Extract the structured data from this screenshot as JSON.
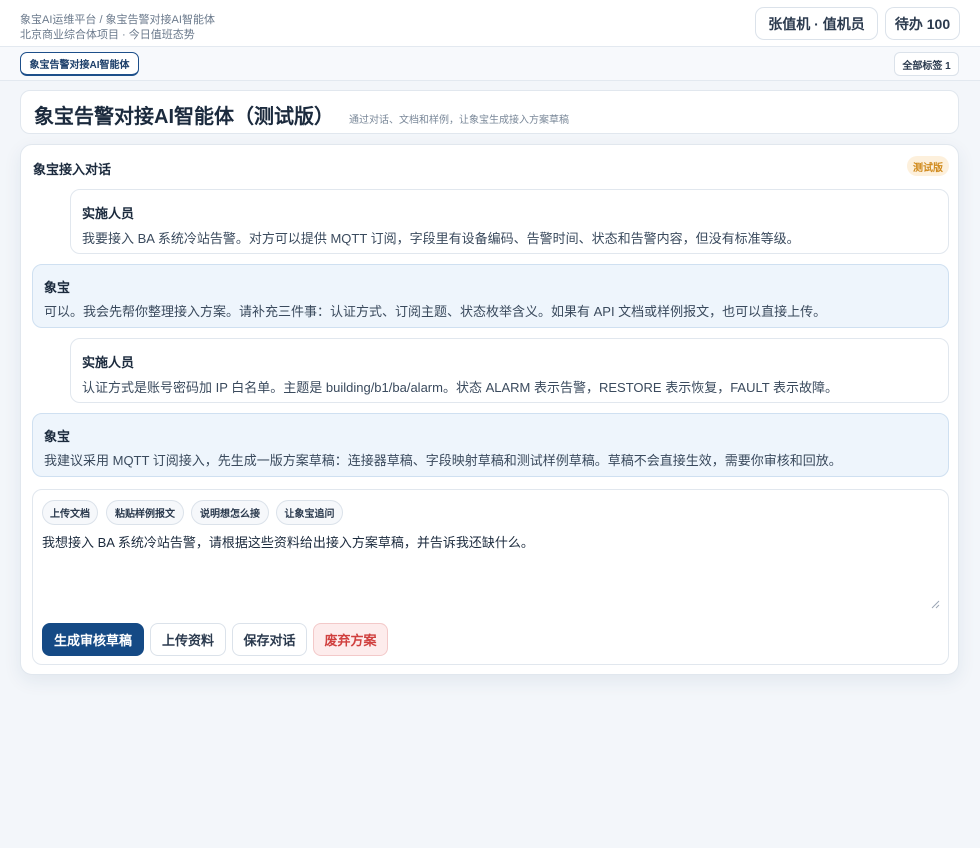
{
  "header": {
    "breadcrumb": "象宝AI运维平台 / 象宝告警对接AI智能体",
    "subtitle": "北京商业综合体项目 · 今日值班态势",
    "user_label": "张值机 · 值机员",
    "todo_label": "待办 100"
  },
  "tabs": {
    "active_label": "象宝告警对接AI智能体",
    "all_tags_label": "全部标签 1"
  },
  "page": {
    "title": "象宝告警对接AI智能体（测试版）",
    "description": "通过对话、文档和样例，让象宝生成接入方案草稿"
  },
  "conversation": {
    "title": "象宝接入对话",
    "badge": "测试版",
    "messages": [
      {
        "sender": "实施人员",
        "text": "我要接入 BA 系统冷站告警。对方可以提供 MQTT 订阅，字段里有设备编码、告警时间、状态和告警内容，但没有标准等级。"
      },
      {
        "sender": "象宝",
        "text": "可以。我会先帮你整理接入方案。请补充三件事：认证方式、订阅主题、状态枚举含义。如果有 API 文档或样例报文，也可以直接上传。"
      },
      {
        "sender": "实施人员",
        "text": "认证方式是账号密码加 IP 白名单。主题是 building/b1/ba/alarm。状态 ALARM 表示告警，RESTORE 表示恢复，FAULT 表示故障。"
      },
      {
        "sender": "象宝",
        "text": "我建议采用 MQTT 订阅接入，先生成一版方案草稿：连接器草稿、字段映射草稿和测试样例草稿。草稿不会直接生效，需要你审核和回放。"
      }
    ]
  },
  "composer": {
    "chips": [
      "上传文档",
      "粘贴样例报文",
      "说明想怎么接",
      "让象宝追问"
    ],
    "input_value": "我想接入 BA 系统冷站告警，请根据这些资料给出接入方案草稿，并告诉我还缺什么。",
    "actions": {
      "generate": "生成审核草稿",
      "upload": "上传资料",
      "save": "保存对话",
      "discard": "废弃方案"
    }
  },
  "colors": {
    "primary": "#154a85",
    "danger": "#d0403f",
    "badge": "#d08a1c",
    "bot_bubble": "#eef5fc"
  }
}
